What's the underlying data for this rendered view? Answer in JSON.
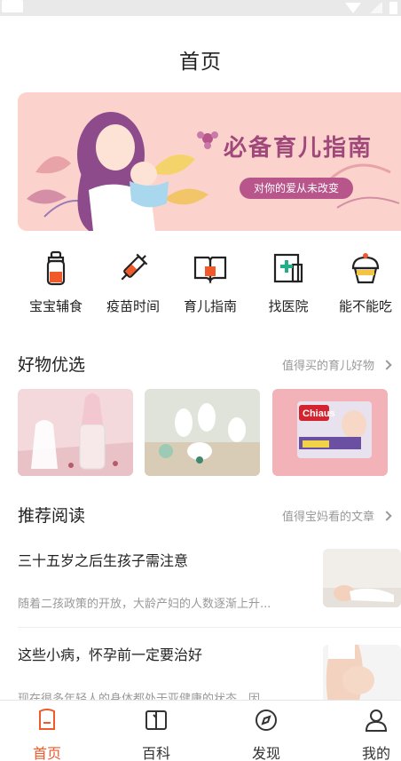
{
  "header": {
    "title": "首页"
  },
  "banner": {
    "title": "必备育儿指南",
    "subtitle": "对你的爱从未改变"
  },
  "categories": [
    {
      "label": "宝宝辅食",
      "icon": "baby-bottle-icon"
    },
    {
      "label": "疫苗时间",
      "icon": "syringe-icon"
    },
    {
      "label": "育儿指南",
      "icon": "open-book-icon"
    },
    {
      "label": "找医院",
      "icon": "hospital-icon"
    },
    {
      "label": "能不能吃",
      "icon": "cupcake-icon"
    }
  ],
  "goods": {
    "title": "好物优选",
    "more": "值得买的育儿好物",
    "items": [
      {
        "name": "baby feeding bottle"
      },
      {
        "name": "baby shoes"
      },
      {
        "name": "diapers",
        "brand": "Chiaus"
      }
    ]
  },
  "reading": {
    "title": "推荐阅读",
    "more": "值得宝妈看的文章",
    "articles": [
      {
        "title": "三十五岁之后生孩子需注意",
        "desc": "随着二孩政策的开放，大龄产妇的人数逐渐上升..."
      },
      {
        "title": "这些小病，怀孕前一定要治好",
        "desc": "现在很多年轻人的身体都处于亚健康的状态，因..."
      }
    ]
  },
  "nav": [
    {
      "label": "首页",
      "icon": "home-icon",
      "active": true
    },
    {
      "label": "百科",
      "icon": "book-icon",
      "active": false
    },
    {
      "label": "发现",
      "icon": "compass-icon",
      "active": false
    },
    {
      "label": "我的",
      "icon": "user-icon",
      "active": false
    }
  ],
  "colors": {
    "accent": "#f05a2a",
    "banner_bg": "#fbd3cc",
    "banner_title": "#a0487a"
  }
}
